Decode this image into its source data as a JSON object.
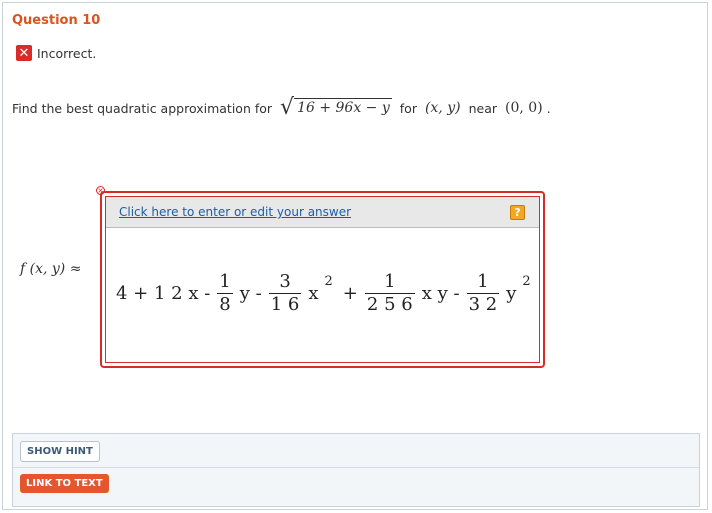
{
  "question": {
    "title": "Question 10"
  },
  "status": {
    "label": "Incorrect.",
    "icon": "x-icon",
    "color": "#d92b2b"
  },
  "prompt": {
    "lead": "Find the best quadratic approximation for",
    "radicand": "16 + 96x − y",
    "for_word": "for",
    "variables": "(x, y)",
    "near_word": "near",
    "point": "(0, 0)",
    "period": "."
  },
  "answer": {
    "lhs": "f (x, y) ≈",
    "link_label": "Click here to enter or edit your answer",
    "help_label": "?",
    "expression": {
      "t1": "4 + 1 2 x -",
      "f1_num": "1",
      "f1_den": "8",
      "t2": "y -",
      "f2_num": "3",
      "f2_den": "1 6",
      "t3": "x",
      "sup1": "2",
      "t4": "+",
      "f3_num": "1",
      "f3_den": "2 5 6",
      "t5": "x y -",
      "f4_num": "1",
      "f4_den": "3 2",
      "t6": "y",
      "sup2": "2"
    }
  },
  "buttons": {
    "show_hint": "SHOW HINT",
    "link_to_text": "LINK TO TEXT"
  },
  "colors": {
    "accent": "#d9541e",
    "error": "#d62b2b",
    "link": "#1a5ea8"
  }
}
